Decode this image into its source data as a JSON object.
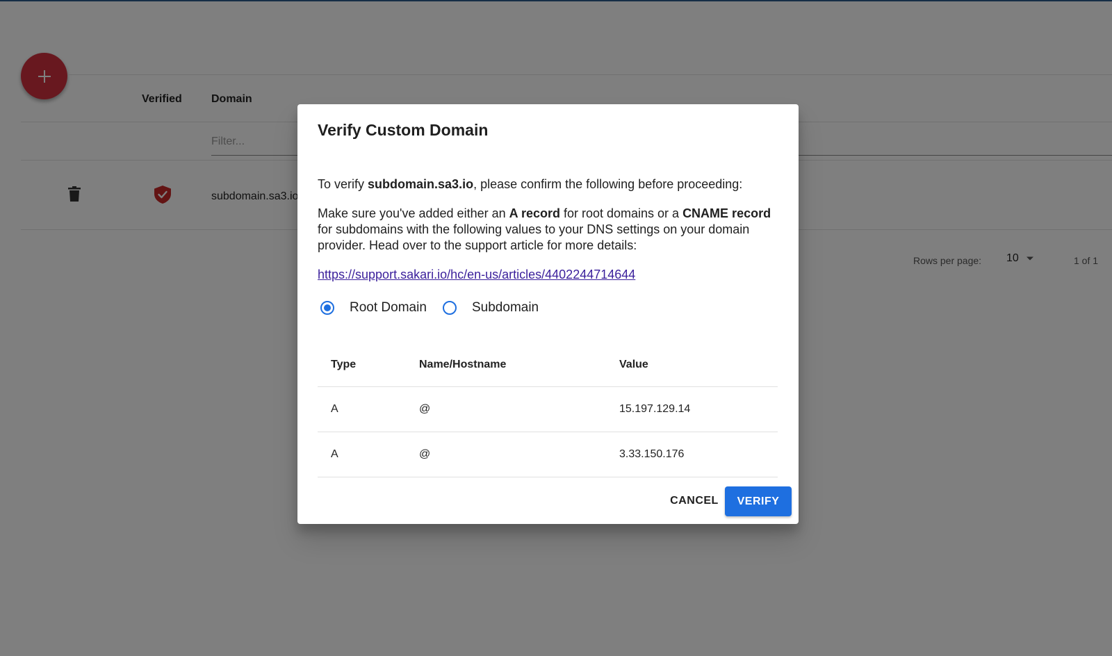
{
  "table": {
    "headers": {
      "verified": "Verified",
      "domain": "Domain"
    },
    "filter_placeholder": "Filter...",
    "rows": [
      {
        "domain": "subdomain.sa3.io",
        "verified": true
      }
    ],
    "pagination": {
      "rows_per_page_label": "Rows per page:",
      "rows_per_page_value": "10",
      "range": "1 of 1"
    }
  },
  "dialog": {
    "title": "Verify Custom Domain",
    "intro_prefix": "To verify ",
    "domain": "subdomain.sa3.io",
    "intro_suffix": ", please confirm the following before proceeding:",
    "instructions": {
      "part1": "Make sure you've added either an ",
      "a_record": "A record",
      "part2": " for root domains or a ",
      "cname_record": "CNAME record",
      "part3": " for subdomains with the following values to your DNS settings on your domain provider. Head over to the support article for more details:"
    },
    "support_link": "https://support.sakari.io/hc/en-us/articles/4402244714644",
    "radio_options": [
      {
        "label": "Root Domain",
        "checked": true
      },
      {
        "label": "Subdomain",
        "checked": false
      }
    ],
    "records": {
      "headers": [
        "Type",
        "Name/Hostname",
        "Value"
      ],
      "rows": [
        [
          "A",
          "@",
          "15.197.129.14"
        ],
        [
          "A",
          "@",
          "3.33.150.176"
        ]
      ]
    },
    "cancel_label": "CANCEL",
    "verify_label": "VERIFY"
  },
  "colors": {
    "fab": "#d1313f",
    "verified_shield": "#c62828",
    "primary": "#1e6fe0",
    "link": "#3a1f9b"
  }
}
